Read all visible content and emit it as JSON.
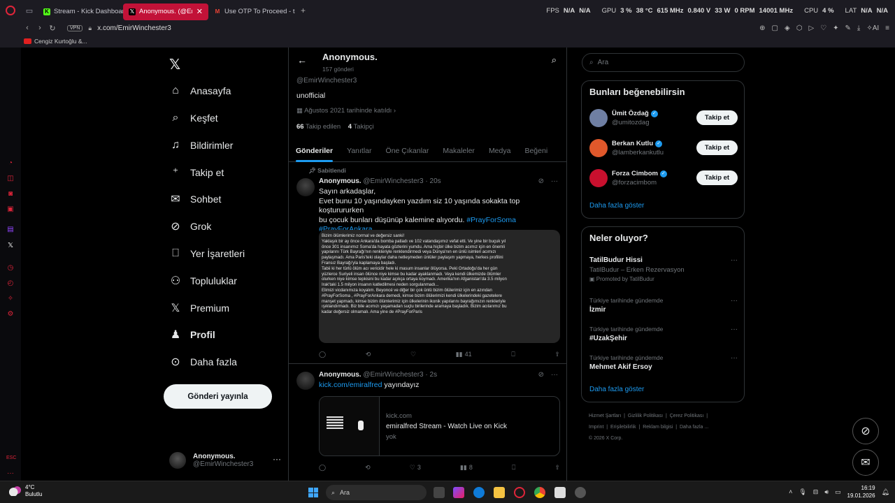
{
  "browser": {
    "tabs": [
      {
        "label": "Stream - Kick Dashboard",
        "favicon": "kick-icon",
        "color": "#53fc18"
      },
      {
        "label": "Anonymous. (@EmirW",
        "favicon": "x-icon",
        "color": "#000000",
        "active": true
      },
      {
        "label": "Use OTP To Proceed - take",
        "favicon": "gmail-icon",
        "color": "#ea4335"
      }
    ],
    "hud": {
      "fps_label": "FPS",
      "fps_val1": "N/A",
      "fps_val2": "N/A",
      "gpu_label": "GPU",
      "gpu_load": "3 %",
      "gpu_temp": "38 °C",
      "gpu_clock": "615 MHz",
      "gpu_volt": "0.840 V",
      "gpu_power": "33 W",
      "gpu_fan": "0 RPM",
      "gpu_mem": "14001 MHz",
      "cpu_label": "CPU",
      "cpu_load": "4 %",
      "lat_label": "LAT",
      "lat_val1": "N/A",
      "lat_val2": "N/A"
    },
    "vpn_label": "VPN",
    "url": "x.com/EmirWinchester3",
    "bookmark": "Cengiz Kurtoğlu &...",
    "ai_label": "AI"
  },
  "nav": {
    "items": [
      {
        "label": "Anasayfa",
        "icon": "home-icon"
      },
      {
        "label": "Keşfet",
        "icon": "search-icon"
      },
      {
        "label": "Bildirimler",
        "icon": "bell-icon"
      },
      {
        "label": "Takip et",
        "icon": "add-user-icon"
      },
      {
        "label": "Sohbet",
        "icon": "mail-icon"
      },
      {
        "label": "Grok",
        "icon": "grok-icon"
      },
      {
        "label": "Yer İşaretleri",
        "icon": "bookmark-icon"
      },
      {
        "label": "Topluluklar",
        "icon": "communities-icon"
      },
      {
        "label": "Premium",
        "icon": "x-icon"
      },
      {
        "label": "Profil",
        "icon": "person-icon"
      },
      {
        "label": "Daha fazla",
        "icon": "more-circle-icon"
      }
    ],
    "post_button": "Gönderi yayınla",
    "me": {
      "name": "Anonymous.",
      "handle": "@EmirWinchester3"
    }
  },
  "profile": {
    "name": "Anonymous.",
    "post_count": "157 gönderi",
    "handle": "@EmirWinchester3",
    "bio": "unofficial",
    "joined": "Ağustos 2021 tarihinde katıldı",
    "following_count": "66",
    "following_label": "Takip edilen",
    "followers_count": "4",
    "followers_label": "Takipçi",
    "tabs": [
      "Gönderiler",
      "Yanıtlar",
      "Öne Çıkanlar",
      "Makaleler",
      "Medya",
      "Beğeni"
    ]
  },
  "tweets": [
    {
      "pinned_label": "Sabitlendi",
      "name": "Anonymous.",
      "handle": "@EmirWinchester3",
      "time": "20s",
      "line1": "Sayın arkadaşlar,",
      "line2": "Evet bunu 10 yaşındayken yazdım siz 10 yaşında sokakta top koşturururken",
      "line3a": "bu çocuk bunları düşünüp kalemine alıyordu.",
      "tag1": "#PrayForSoma",
      "tag2": "#PrayForAnkara",
      "image_text": [
        "Bizim ölümlerimiz normal ve değersiz sanki!",
        "Yaklaşık bir ay önce Ankara'da bomba patladı ve 102 vatandaşımız vefat etti. Ve yine bir buçuk yıl",
        "önce 301 insanımız Soma'da hayata gözlerini yumdu. Ama hiçbir ülke bizim acımız için en önemli",
        "yapılarını Türk Bayrağı'nın renkleriyle renklendirmedi veya Dünya'nın en ünlü isimleri acımızı",
        "paylaşmadı. Ama Paris'teki olaylar daha netleşmeden ünlüler paylaşım yapmaya, herkes profilini",
        "Fransız Bayrağı'yla kaplamaya başladı.",
        "Tabii ki her türlü ölüm acı vericidir hele ki masum insanlar ölüyorsa. Peki Ortadoğu'da her gün",
        "yüzlerce Suriyeli insan ölünce niye kimse bu kadar ayaklanmadı. Veya kendi ülkemizde ölümler",
        "olurken niye kimse tepkisini bu kadar açıkça ortaya koymadı. Amerika'nın Afganistan'da 3.5 milyon",
        "Irak'taki 1.5 milyon insanın katledilmesi neden sorgulanmadı...",
        "Elimizi vicdanımıza koyalım. Beyoncé ve diğer bir çok ünlü bizim ölülerimiz için en azından",
        "#PrayForSoma , #PrayForAnkara demedi, kimse bizim ölülerimizi kendi ülkelerindeki gazetelere",
        "manşet yapmadı, kimse bizim ölümlerimiz için ülkelerinin ikonik yapılarını bayrağımızın renkleriyle",
        "ışıklandırmadı. Biz bile acımızı yaşamadan suçlu birilerinde aramaya başladık. Bizim acılarımız bu",
        "kadar değersiz olmamalı. Ama yine de #PrayForParis"
      ],
      "views": "41"
    },
    {
      "name": "Anonymous.",
      "handle": "@EmirWinchester3",
      "time": "2s",
      "link": "kick.com/emiralfred",
      "text_rest": "yayındayız",
      "card": {
        "domain": "kick.com",
        "title": "emiralfred Stream - Watch Live on Kick",
        "desc": "yok"
      },
      "likes": "3",
      "views": "8"
    }
  ],
  "right": {
    "search_placeholder": "Ara",
    "who_title": "Bunları beğenebilirsin",
    "who": [
      {
        "name": "Ümit Özdağ",
        "handle": "@umitozdag",
        "color": "#6f7fa3"
      },
      {
        "name": "Berkan Kutlu",
        "handle": "@lamberkankutlu",
        "color": "#e0582b"
      },
      {
        "name": "Forza Cimbom",
        "handle": "@forzacimbom",
        "color": "#c8102e"
      }
    ],
    "follow_label": "Takip et",
    "show_more": "Daha fazla göster",
    "trends_title": "Neler oluyor?",
    "trends": [
      {
        "context": "",
        "title": "TatilBudur Hissi",
        "sub": "TatilBudur – Erken Rezervasyon",
        "promo": "Promoted by TatilBudur"
      },
      {
        "context": "Türkiye tarihinde gündemde",
        "title": "İzmir"
      },
      {
        "context": "Türkiye tarihinde gündemde",
        "title": "#UzakŞehir"
      },
      {
        "context": "Türkiye tarihinde gündemde",
        "title": "Mehmet Akif Ersoy"
      }
    ],
    "footer": [
      "Hizmet Şartları",
      "Gizlilik Politikası",
      "Çerez Politikası",
      "Imprint",
      "Erişilebilirlik",
      "Reklam bilgisi",
      "Daha fazla ...",
      "© 2026 X Corp."
    ]
  },
  "taskbar": {
    "temp": "4°C",
    "weather": "Bulutlu",
    "search": "Ara",
    "time": "16:19",
    "date": "19.01.2026"
  }
}
